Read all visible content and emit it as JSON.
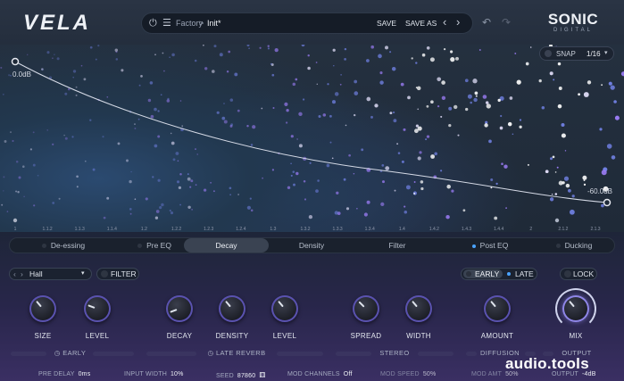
{
  "header": {
    "logo": "VELA",
    "breadcrumb_root": "Factory",
    "breadcrumb_sep": ">",
    "preset_name": "Init*",
    "save_label": "SAVE",
    "save_as_label": "SAVE AS",
    "prev_glyph": "‹",
    "next_glyph": "›",
    "undo_glyph": "↶",
    "redo_glyph": "↷",
    "brand_main": "SONIC",
    "brand_sub": "DIGITAL"
  },
  "visualizer": {
    "snap_label": "SNAP",
    "snap_value": "1/16",
    "curve_start_label": "0.0dB",
    "curve_end_label": "-60.0dB",
    "ruler_labels": [
      "1",
      "1.1.2",
      "1.1.3",
      "1.1.4",
      "1.2",
      "1.2.2",
      "1.2.3",
      "1.2.4",
      "1.3",
      "1.3.2",
      "1.3.3",
      "1.3.4",
      "1.4",
      "1.4.2",
      "1.4.3",
      "1.4.4",
      "2",
      "2.1.2",
      "2.1.3"
    ]
  },
  "tabs": [
    {
      "label": "De-essing",
      "active": false
    },
    {
      "label": "Pre EQ",
      "active": false
    },
    {
      "label": "Decay",
      "active": true
    },
    {
      "label": "Density",
      "active": false
    },
    {
      "label": "Filter",
      "active": false
    },
    {
      "label": "Post EQ",
      "active": false
    },
    {
      "label": "Ducking",
      "active": false
    }
  ],
  "controls": {
    "mode_value": "Hall",
    "filter_label": "FILTER",
    "early_label": "EARLY",
    "late_label": "LATE",
    "lock_label": "LOCK"
  },
  "knobs": [
    {
      "label": "SIZE"
    },
    {
      "label": "LEVEL"
    },
    {
      "label": "DECAY"
    },
    {
      "label": "DENSITY"
    },
    {
      "label": "LEVEL"
    },
    {
      "label": "SPREAD"
    },
    {
      "label": "WIDTH"
    },
    {
      "label": "AMOUNT"
    },
    {
      "label": "MIX"
    }
  ],
  "sections": {
    "early": "EARLY",
    "late_reverb": "LATE REVERB",
    "stereo": "STEREO",
    "diffusion": "DIFFUSION",
    "output": "OUTPUT"
  },
  "params": [
    {
      "label": "PRE DELAY",
      "value": "0ms"
    },
    {
      "label": "INPUT WIDTH",
      "value": "10%"
    },
    {
      "label": "SEED",
      "value": "87860"
    },
    {
      "label": "MOD CHANNELS",
      "value": "Off"
    },
    {
      "label": "MOD SPEED",
      "value": "50%"
    },
    {
      "label": "MOD AMT",
      "value": "50%"
    },
    {
      "label": "OUTPUT",
      "value": "-4dB"
    }
  ],
  "watermark": "audio.tools",
  "colors": {
    "accent": "#7a6cf0",
    "active_dot": "#4aa3ff",
    "particle": "#a990ff"
  }
}
